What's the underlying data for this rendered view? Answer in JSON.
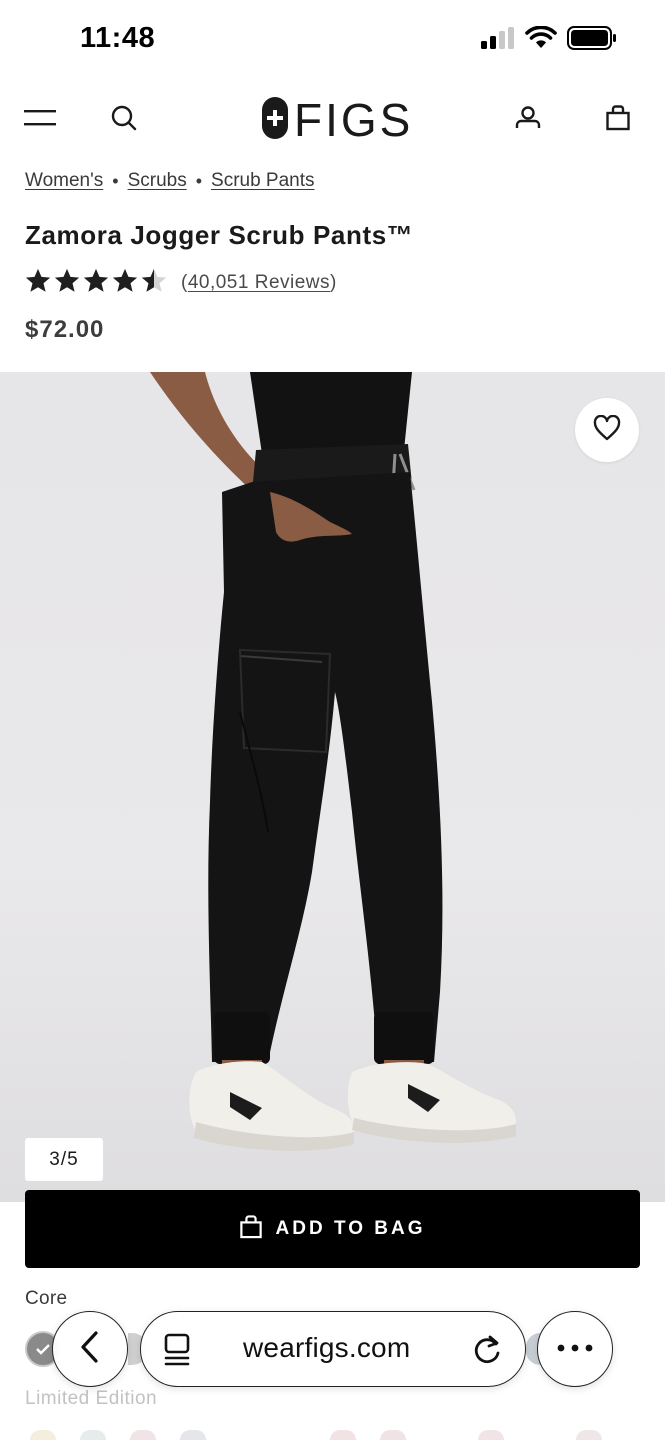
{
  "status_bar": {
    "time": "11:48",
    "icons": [
      "cellular-signal-icon",
      "wifi-icon",
      "battery-icon"
    ]
  },
  "header": {
    "menu_icon": "hamburger-menu-icon",
    "search_icon": "search-icon",
    "logo_text": "FIGS",
    "account_icon": "account-icon",
    "bag_icon": "shopping-bag-icon"
  },
  "breadcrumb": {
    "items": [
      "Women's",
      "Scrubs",
      "Scrub Pants"
    ],
    "separator": "•"
  },
  "product": {
    "title": "Zamora Jogger Scrub Pants™",
    "rating": 4.5,
    "rating_max": 5,
    "reviews_label": "40,051 Reviews",
    "price": "$72.00"
  },
  "gallery": {
    "counter": "3/5",
    "current": 3,
    "total": 5,
    "wishlist_icon": "heart-icon"
  },
  "add_to_bag": {
    "label": "ADD TO BAG",
    "icon": "shopping-bag-icon"
  },
  "colors": {
    "core_label": "Core",
    "limited_label": "Limited Edition",
    "selected_swatch": "#8a8a8a"
  },
  "browser": {
    "url": "wearfigs.com",
    "back_icon": "chevron-left-icon",
    "tabs_icon": "tabs-icon",
    "reload_icon": "reload-icon",
    "more_icon": "more-icon"
  },
  "theme": {
    "accent": "#000000",
    "background": "#ffffff",
    "image_background": "#e8e7e9"
  }
}
